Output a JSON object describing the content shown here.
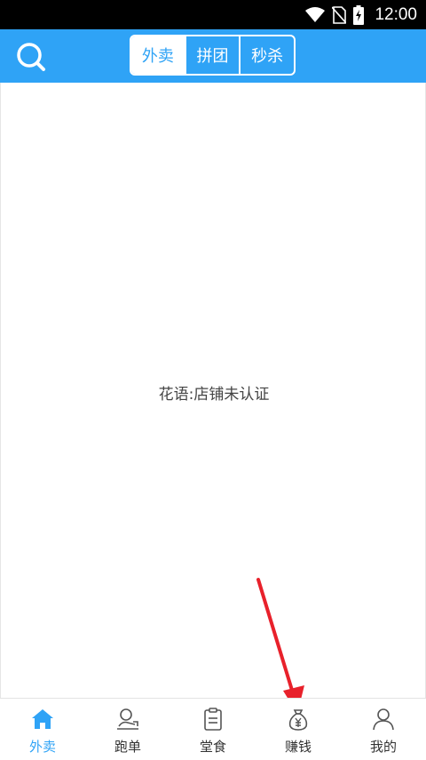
{
  "status_bar": {
    "time": "12:00",
    "icons": [
      "wifi-icon",
      "no-sim-icon",
      "battery-charging-icon"
    ]
  },
  "header": {
    "search_icon": "search-icon",
    "tabs": [
      {
        "label": "外卖",
        "active": true
      },
      {
        "label": "拼团",
        "active": false
      },
      {
        "label": "秒杀",
        "active": false
      }
    ]
  },
  "main": {
    "message": "花语:店铺未认证"
  },
  "bottom_nav": {
    "items": [
      {
        "label": "外卖",
        "icon": "home-icon",
        "active": true
      },
      {
        "label": "跑单",
        "icon": "courier-icon",
        "active": false
      },
      {
        "label": "堂食",
        "icon": "clipboard-icon",
        "active": false
      },
      {
        "label": "赚钱",
        "icon": "money-bag-icon",
        "active": false
      },
      {
        "label": "我的",
        "icon": "user-icon",
        "active": false
      }
    ]
  },
  "colors": {
    "accent": "#2fa3f6",
    "status_bar": "#000000",
    "annotation_arrow": "#e8212b"
  }
}
